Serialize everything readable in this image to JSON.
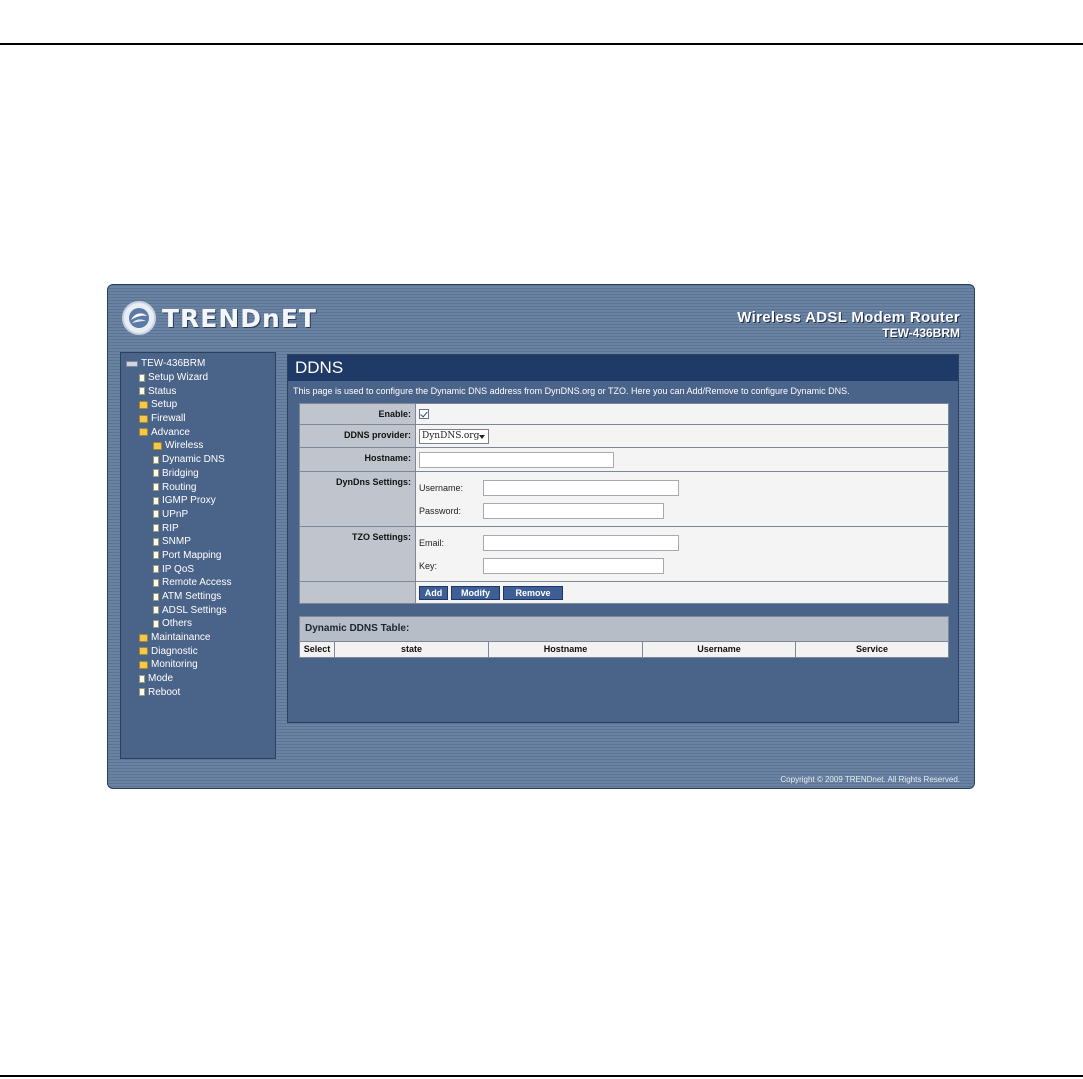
{
  "brand": {
    "logo_text": "TRENDnET",
    "product_name": "Wireless ADSL Modem Router",
    "model": "TEW-436BRM"
  },
  "sidebar": {
    "root": "TEW-436BRM",
    "items": [
      {
        "label": "Setup Wizard",
        "icon": "doc-icon",
        "level": "top"
      },
      {
        "label": "Status",
        "icon": "doc-icon",
        "level": "top"
      },
      {
        "label": "Setup",
        "icon": "folder-icon",
        "level": "top"
      },
      {
        "label": "Firewall",
        "icon": "folder-icon",
        "level": "top"
      },
      {
        "label": "Advance",
        "icon": "folder-open-icon",
        "level": "top"
      },
      {
        "label": "Wireless",
        "icon": "folder-icon",
        "level": "child"
      },
      {
        "label": "Dynamic DNS",
        "icon": "doc-icon",
        "level": "child"
      },
      {
        "label": "Bridging",
        "icon": "doc-icon",
        "level": "child"
      },
      {
        "label": "Routing",
        "icon": "doc-icon",
        "level": "child"
      },
      {
        "label": "IGMP Proxy",
        "icon": "doc-icon",
        "level": "child"
      },
      {
        "label": "UPnP",
        "icon": "doc-icon",
        "level": "child"
      },
      {
        "label": "RIP",
        "icon": "doc-icon",
        "level": "child"
      },
      {
        "label": "SNMP",
        "icon": "doc-icon",
        "level": "child"
      },
      {
        "label": "Port Mapping",
        "icon": "doc-icon",
        "level": "child"
      },
      {
        "label": "IP QoS",
        "icon": "doc-icon",
        "level": "child"
      },
      {
        "label": "Remote Access",
        "icon": "doc-icon",
        "level": "child"
      },
      {
        "label": "ATM Settings",
        "icon": "doc-icon",
        "level": "child"
      },
      {
        "label": "ADSL Settings",
        "icon": "doc-icon",
        "level": "child"
      },
      {
        "label": "Others",
        "icon": "doc-icon",
        "level": "child"
      },
      {
        "label": "Maintainance",
        "icon": "folder-icon",
        "level": "top"
      },
      {
        "label": "Diagnostic",
        "icon": "folder-icon",
        "level": "top"
      },
      {
        "label": "Monitoring",
        "icon": "folder-icon",
        "level": "top"
      },
      {
        "label": "Mode",
        "icon": "doc-icon",
        "level": "top"
      },
      {
        "label": "Reboot",
        "icon": "doc-icon",
        "level": "top"
      }
    ]
  },
  "main": {
    "title": "DDNS",
    "description": "This page is used to configure the Dynamic DNS address from DynDNS.org or TZO. Here you can Add/Remove to configure Dynamic DNS.",
    "form": {
      "enable_label": "Enable:",
      "enable_checked": true,
      "provider_label": "DDNS provider:",
      "provider_value": "DynDNS.org",
      "hostname_label": "Hostname:",
      "hostname_value": "",
      "dyndns_label": "DynDns Settings:",
      "username_label": "Username:",
      "password_label": "Password:",
      "tzo_label": "TZO Settings:",
      "email_label": "Email:",
      "key_label": "Key:",
      "buttons": {
        "add": "Add",
        "modify": "Modify",
        "remove": "Remove"
      }
    },
    "table": {
      "title": "Dynamic DDNS Table:",
      "columns": [
        "Select",
        "state",
        "Hostname",
        "Username",
        "Service"
      ]
    }
  },
  "footer": {
    "copyright": "Copyright © 2009 TRENDnet. All Rights Reserved."
  }
}
